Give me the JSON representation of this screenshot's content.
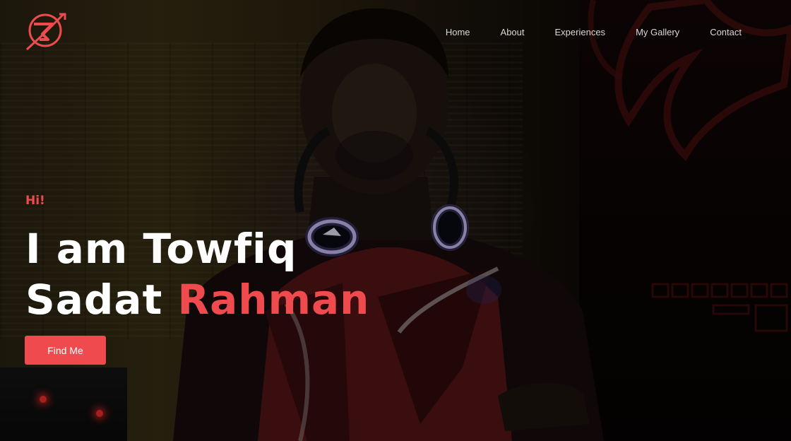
{
  "nav": {
    "items": [
      {
        "label": "Home"
      },
      {
        "label": "About"
      },
      {
        "label": "Experiences"
      },
      {
        "label": "My Gallery"
      },
      {
        "label": "Contact"
      }
    ]
  },
  "hero": {
    "greeting": "Hi!",
    "line1": "I am Towfiq",
    "line2_white": "Sadat",
    "line2_accent": "Rahman",
    "button_label": "Find Me"
  },
  "colors": {
    "accent": "#ef4b4f",
    "nav_text": "#d8d8d8",
    "headline": "#ffffff"
  },
  "icons": {
    "logo": "brand-logo-icon"
  }
}
